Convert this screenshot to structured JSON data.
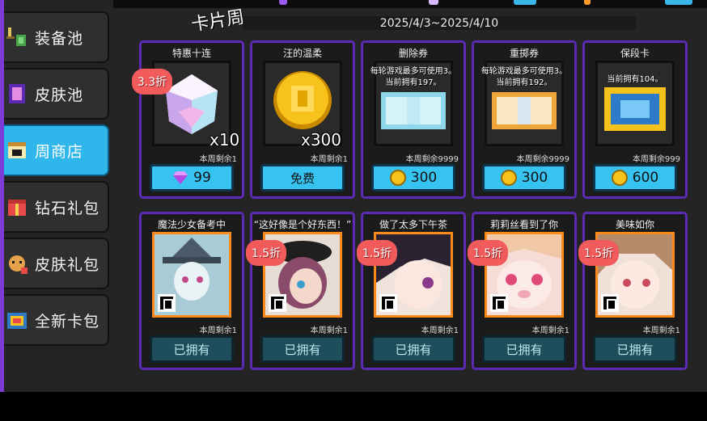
{
  "header": {
    "title": "卡片周",
    "date_range": "2025/4/3~2025/4/10"
  },
  "sidebar": {
    "items": [
      {
        "label": "装备池",
        "icon": "equipment-icon"
      },
      {
        "label": "皮肤池",
        "icon": "skin-pool-icon"
      },
      {
        "label": "周商店",
        "icon": "weekly-shop-icon",
        "active": true
      },
      {
        "label": "钻石礼包",
        "icon": "diamond-gift-icon"
      },
      {
        "label": "皮肤礼包",
        "icon": "skin-gift-icon"
      },
      {
        "label": "全新卡包",
        "icon": "card-pack-icon"
      }
    ]
  },
  "row1": [
    {
      "title": "特惠十连",
      "discount": "3.3折",
      "qty": "x10",
      "stock": "本周剩余1",
      "price": "99",
      "currency": "gem-icon"
    },
    {
      "title": "汪的温柔",
      "qty": "x300",
      "stock": "本周剩余1",
      "price": "免费"
    },
    {
      "title": "删除券",
      "info1": "每轮游戏最多可使用3。",
      "info2": "当前拥有197。",
      "stock": "本周剩余9999",
      "price": "300",
      "currency": "coin-icon"
    },
    {
      "title": "重掷券",
      "info1": "每轮游戏最多可使用3。",
      "info2": "当前拥有192。",
      "stock": "本周剩余9999",
      "price": "300",
      "currency": "coin-icon"
    },
    {
      "title": "保段卡",
      "info2": "当前拥有104。",
      "stock": "本周剩余999",
      "price": "600",
      "currency": "coin-icon"
    }
  ],
  "row2": [
    {
      "title": "魔法少女备考中",
      "stock": "本周剩余1",
      "button": "已拥有"
    },
    {
      "title": "“这好像是个好东西！”",
      "discount": "1.5折",
      "stock": "本周剩余1",
      "button": "已拥有"
    },
    {
      "title": "做了太多下午茶",
      "discount": "1.5折",
      "stock": "本周剩余1",
      "button": "已拥有"
    },
    {
      "title": "莉莉丝看到了你",
      "discount": "1.5折",
      "stock": "本周剩余1",
      "button": "已拥有"
    },
    {
      "title": "美味如你",
      "discount": "1.5折",
      "stock": "本周剩余1",
      "button": "已拥有"
    }
  ],
  "colors": {
    "accent": "#2fb6ea",
    "card_border": "#5c2bb3",
    "badge": "#f15b5b",
    "orange_frame": "#ff8a1c"
  }
}
